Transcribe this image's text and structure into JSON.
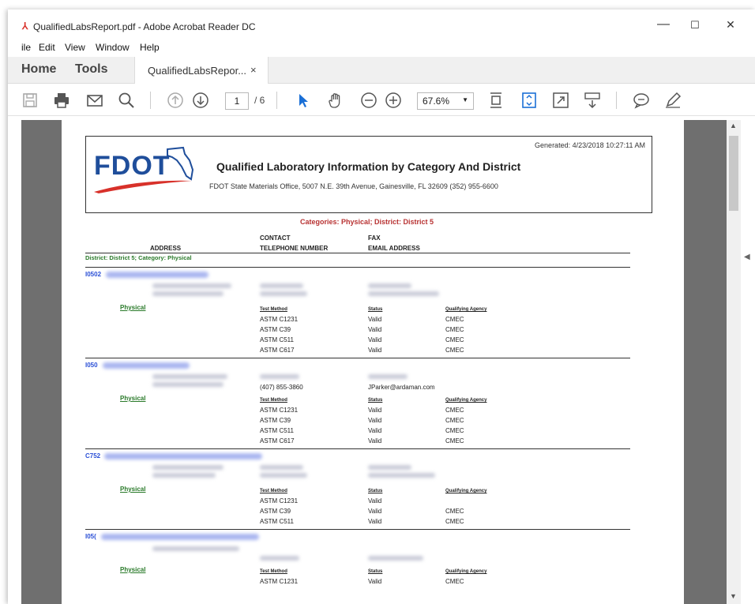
{
  "window": {
    "title": "QualifiedLabsReport.pdf - Adobe Acrobat Reader DC",
    "minimize": "—",
    "maximize": "☐",
    "close": "✕"
  },
  "menu": [
    "ile",
    "Edit",
    "View",
    "Window",
    "Help"
  ],
  "tabs": {
    "home": "Home",
    "tools": "Tools",
    "document": "QualifiedLabsRepor...",
    "close": "×"
  },
  "toolbar": {
    "page_current": "1",
    "page_total": "/ 6",
    "zoom": "67.6%"
  },
  "report": {
    "logo": "FDOT",
    "generated": "Generated: 4/23/2018 10:27:11 AM",
    "title": "Qualified Laboratory Information by Category And District",
    "subtitle": "FDOT State Materials Office, 5007 N.E. 39th Avenue, Gainesville, FL 32609 (352) 955-6600",
    "categories": "Categories: Physical; District: District 5",
    "columns": {
      "address": "ADDRESS",
      "contact": "CONTACT",
      "telephone": "TELEPHONE NUMBER",
      "fax": "FAX",
      "email": "EMAIL ADDRESS"
    },
    "district_line": "District: District 5; Category: Physical",
    "test_headers": {
      "method": "Test Method",
      "status": "Status",
      "agency": "Qualifying Agency"
    },
    "labs": [
      {
        "id": "I0502",
        "category": "Physical",
        "phone": "",
        "email": "",
        "tests": [
          {
            "method": "ASTM C1231",
            "status": "Valid",
            "agency": "CMEC"
          },
          {
            "method": "ASTM C39",
            "status": "Valid",
            "agency": "CMEC"
          },
          {
            "method": "ASTM C511",
            "status": "Valid",
            "agency": "CMEC"
          },
          {
            "method": "ASTM C617",
            "status": "Valid",
            "agency": "CMEC"
          }
        ]
      },
      {
        "id": "I050",
        "category": "Physical",
        "phone": "(407) 855-3860",
        "email": "JParker@ardaman.com",
        "tests": [
          {
            "method": "ASTM C1231",
            "status": "Valid",
            "agency": "CMEC"
          },
          {
            "method": "ASTM C39",
            "status": "Valid",
            "agency": "CMEC"
          },
          {
            "method": "ASTM C511",
            "status": "Valid",
            "agency": "CMEC"
          },
          {
            "method": "ASTM C617",
            "status": "Valid",
            "agency": "CMEC"
          }
        ]
      },
      {
        "id": "C752",
        "category": "Physical",
        "phone": "",
        "email": "",
        "tests": [
          {
            "method": "ASTM C1231",
            "status": "Valid",
            "agency": ""
          },
          {
            "method": "ASTM C39",
            "status": "Valid",
            "agency": "CMEC"
          },
          {
            "method": "ASTM C511",
            "status": "Valid",
            "agency": "CMEC"
          }
        ]
      },
      {
        "id": "I05(",
        "category": "Physical",
        "phone": "",
        "email": "",
        "tests": [
          {
            "method": "ASTM C1231",
            "status": "Valid",
            "agency": "CMEC"
          }
        ]
      }
    ]
  }
}
